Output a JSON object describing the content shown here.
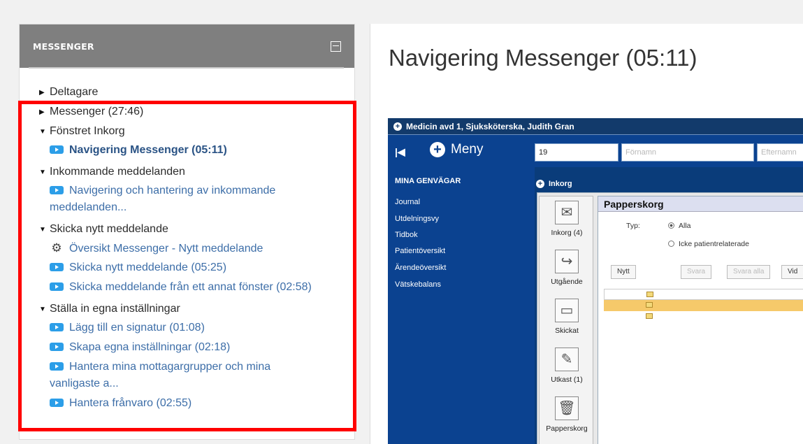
{
  "sidebar": {
    "title": "MESSENGER",
    "sections": [
      {
        "label": "Deltagare",
        "expanded": false
      },
      {
        "label": "Messenger (27:46)",
        "expanded": false
      },
      {
        "label": "Fönstret Inkorg",
        "expanded": true
      },
      {
        "label": "Inkommande meddelanden",
        "expanded": true
      },
      {
        "label": "Skicka nytt meddelande",
        "expanded": true
      },
      {
        "label": "Ställa in egna inställningar",
        "expanded": true
      }
    ],
    "leaves": {
      "nav_messenger": "Navigering Messenger (05:11)",
      "nav_inkommande_1": "Navigering och hantering av inkommande",
      "nav_inkommande_2": "meddelanden...",
      "oversikt": "Översikt Messenger - Nytt meddelande",
      "skicka_nytt": "Skicka nytt meddelande (05:25)",
      "skicka_annat": "Skicka meddelande från ett annat fönster (02:58)",
      "signatur": "Lägg till en signatur (01:08)",
      "egna": "Skapa egna inställningar (02:18)",
      "mottagare_1": "Hantera mina mottagargrupper och mina",
      "mottagare_2": "vanligaste a...",
      "franvaro": "Hantera frånvaro (02:55)"
    }
  },
  "main": {
    "title": "Navigering Messenger (05:11)"
  },
  "screenshot": {
    "topbar": "Medicin avd 1, Sjuksköterska, Judith Gran",
    "menu": "Meny",
    "field_value": "19",
    "field_fornamn": "Förnamn",
    "field_efternamn": "Efternamn",
    "sidebar_title": "MINA GENVÄGAR",
    "sidebar_items": [
      "Journal",
      "Utdelningsvy",
      "Tidbok",
      "Patientöversikt",
      "Ärendeöversikt",
      "Vätskebalans"
    ],
    "inkorg_label": "Inkorg",
    "icons": [
      "Inkorg (4)",
      "Utgående",
      "Skickat",
      "Utkast (1)",
      "Papperskorg"
    ],
    "panel_title": "Papperskorg",
    "typ_label": "Typ:",
    "radio_alla": "Alla",
    "radio_icke": "Icke patientrelaterade",
    "btn_nytt": "Nytt",
    "btn_svara": "Svara",
    "btn_svara_alla": "Svara alla",
    "btn_vid": "Vid"
  },
  "colors": {
    "highlight_box": "#ff0000",
    "link": "#3d6ea8",
    "header_gray": "#7f7f7f",
    "app_blue": "#0b4290"
  }
}
